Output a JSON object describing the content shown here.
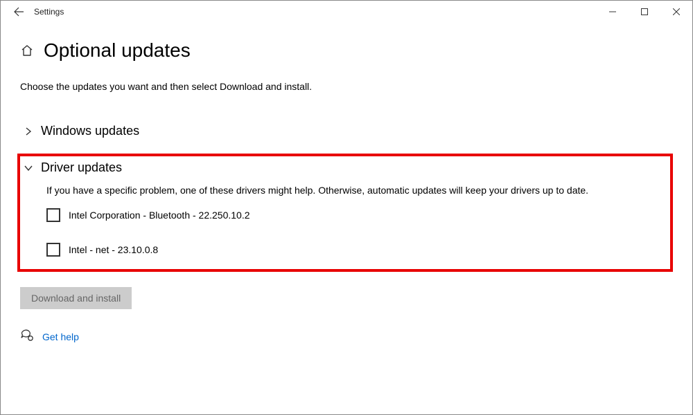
{
  "titlebar": {
    "title": "Settings"
  },
  "page": {
    "heading": "Optional updates",
    "description": "Choose the updates you want and then select Download and install."
  },
  "sections": {
    "windows": {
      "label": "Windows updates",
      "expanded": false
    },
    "driver": {
      "label": "Driver updates",
      "expanded": true,
      "description": "If you have a specific problem, one of these drivers might help. Otherwise, automatic updates will keep your drivers up to date.",
      "items": [
        {
          "label": "Intel Corporation - Bluetooth - 22.250.10.2",
          "checked": false
        },
        {
          "label": "Intel - net - 23.10.0.8",
          "checked": false
        }
      ]
    }
  },
  "actions": {
    "download_install": "Download and install",
    "get_help": "Get help"
  }
}
